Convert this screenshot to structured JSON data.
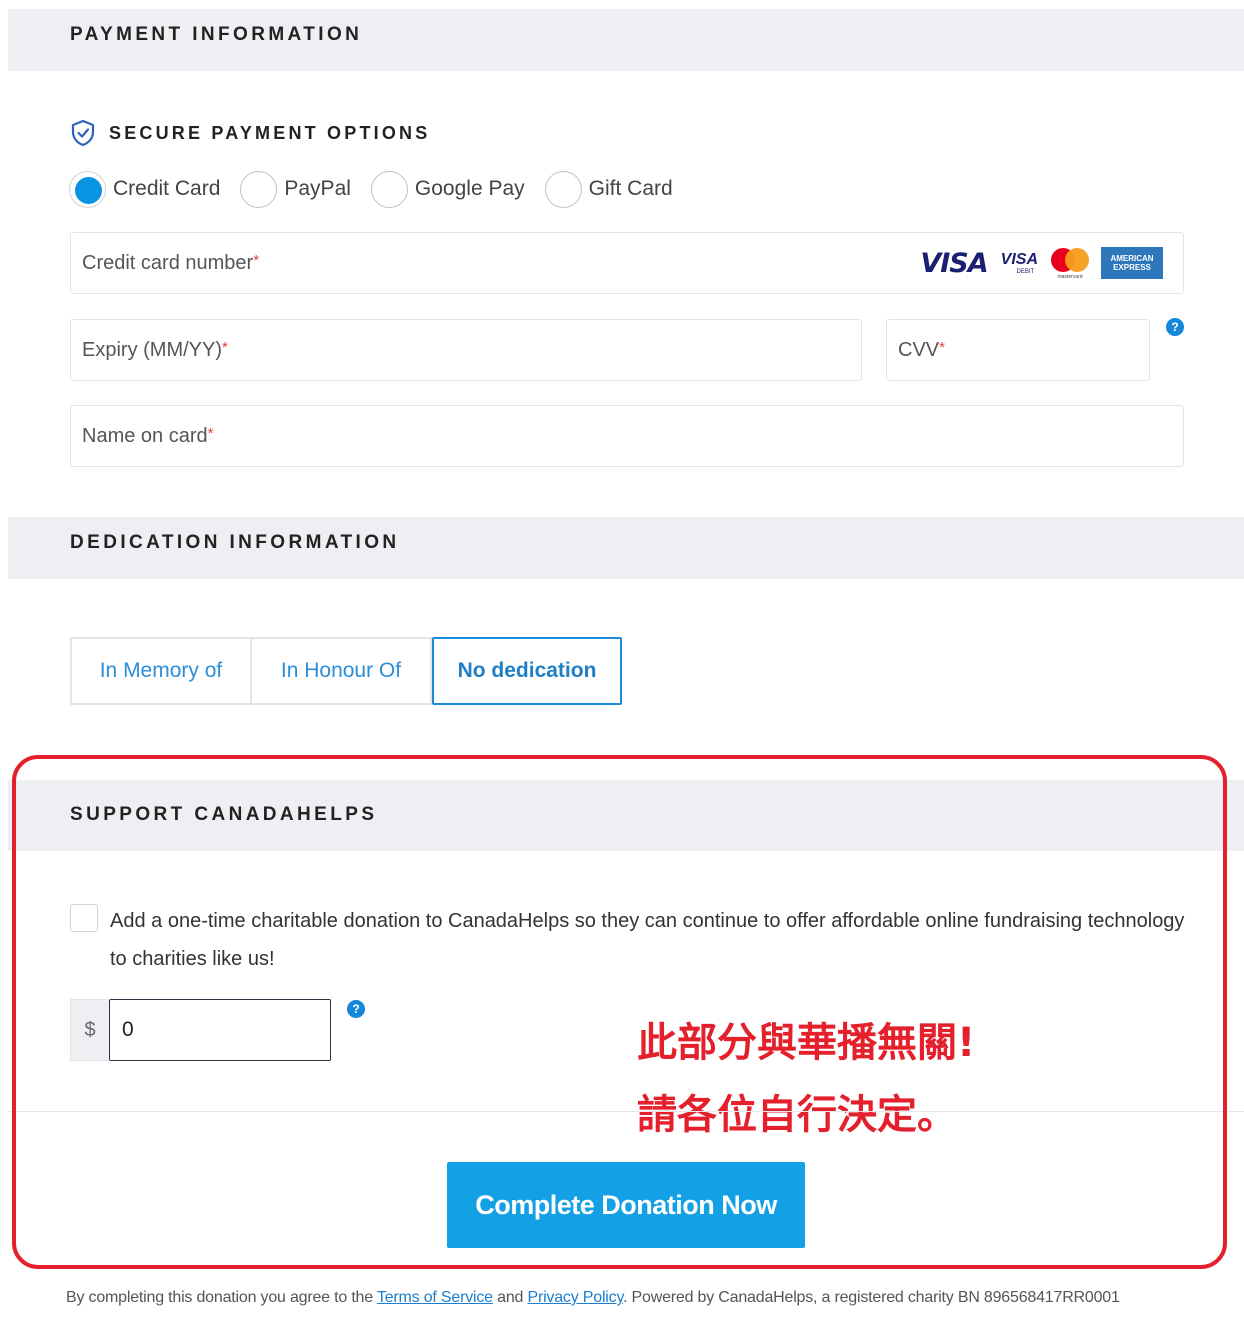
{
  "payment": {
    "header": "PAYMENT INFORMATION",
    "secure_label": "SECURE PAYMENT OPTIONS",
    "methods": [
      {
        "label": "Credit Card",
        "selected": true
      },
      {
        "label": "PayPal",
        "selected": false
      },
      {
        "label": "Google Pay",
        "selected": false
      },
      {
        "label": "Gift Card",
        "selected": false
      }
    ],
    "card_number_placeholder": "Credit card number",
    "expiry_placeholder": "Expiry (MM/YY)",
    "cvv_placeholder": "CVV",
    "name_placeholder": "Name on card",
    "required_marker": "*",
    "card_brands": {
      "visa": "VISA",
      "visa_debit": "VISA",
      "visa_debit_sub": "DEBIT",
      "mastercard_sub": "mastercard",
      "amex_line1": "AMERICAN",
      "amex_line2": "EXPRESS"
    },
    "help_glyph": "?"
  },
  "dedication": {
    "header": "DEDICATION INFORMATION",
    "options": [
      "In Memory of",
      "In Honour Of",
      "No dedication"
    ],
    "selected": "No dedication"
  },
  "support": {
    "header": "SUPPORT CANADAHELPS",
    "checkbox_checked": false,
    "checkbox_text": "Add a one-time charitable donation to CanadaHelps so they can continue to offer affordable online fundraising technology to charities like us!",
    "currency_symbol": "$",
    "amount_value": "0"
  },
  "annotation": {
    "line1": "此部分與華播無關!",
    "line2": "請各位自行決定。"
  },
  "submit_label": "Complete Donation Now",
  "footer": {
    "prefix": "By completing this donation you agree to the ",
    "terms": "Terms of Service",
    "and": " and ",
    "privacy": "Privacy Policy",
    "suffix": ". Powered by CanadaHelps, a registered charity BN 896568417RR0001"
  },
  "colors": {
    "accent": "#14a0e5",
    "radio_selected": "#0a93e0",
    "annotation_red": "#e3202c",
    "header_bg": "#eeeff2"
  }
}
